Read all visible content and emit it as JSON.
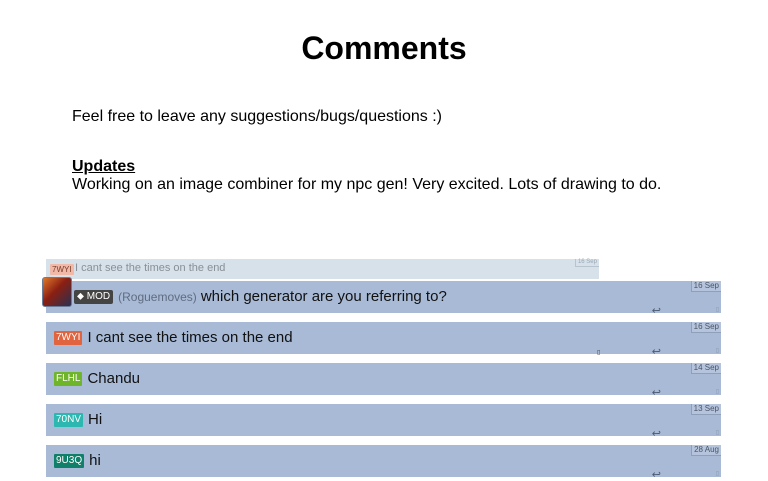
{
  "page": {
    "title": "Comments",
    "intro": "Feel free to leave any suggestions/bugs/questions :)",
    "updates_heading": "Updates",
    "updates_text": "Working on an image combiner for my npc gen! Very excited. Lots of drawing to do."
  },
  "quoted_comment": {
    "tag": "7WYI",
    "text": "I cant see the times on the end",
    "date": "16 Sep"
  },
  "comments": [
    {
      "badge": "⬥ MOD",
      "author": "(Roguemoves)",
      "text": "which generator are you referring to?",
      "date": "16 Sep"
    },
    {
      "tag": "7WYI",
      "tag_color": "#e0643f",
      "text": "I cant see the times on the end",
      "date": "16 Sep"
    },
    {
      "tag": "FLHL",
      "tag_color": "#6fb52a",
      "text": "Chandu",
      "date": "14 Sep"
    },
    {
      "tag": "70NV",
      "tag_color": "#2cb8b0",
      "text": "Hi",
      "date": "13 Sep"
    },
    {
      "tag": "9U3Q",
      "tag_color": "#11806a",
      "text": "hi",
      "date": "28 Aug"
    }
  ],
  "icons": {
    "reply": "↩",
    "flag": "▯"
  },
  "colors": {
    "comment_bg": "#a8bad6",
    "quoted_bg": "#d6e1ea",
    "mod_badge": "#444444"
  }
}
